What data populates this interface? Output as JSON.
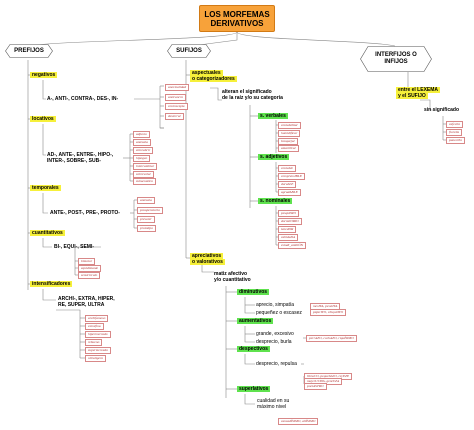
{
  "title": [
    "LOS MORFEMAS",
    "DERIVATIVOS"
  ],
  "branches": {
    "prefijos": "PREFIJOS",
    "sufijos": "SUFIJOS",
    "interfijos": [
      "INTERFIJOS O",
      "INFIJOS"
    ]
  },
  "prefijos": {
    "negativos": {
      "label": "negativos",
      "items": "A-, ANTI-, CONTRA-, DES-, IN-",
      "examples": [
        "anormalidad",
        "anticancro",
        "contraespía",
        "desterrar"
      ]
    },
    "locativos": {
      "label": "locativos",
      "items": [
        "AD-, ANTE-, ENTRE-, HIPO-,",
        "INTER-, SOBRE-, SUB-"
      ],
      "examples": [
        "adjunto",
        "antesala",
        "entreabrir",
        "hipogeo",
        "intercambiar",
        "sobrevolar",
        "subacuático"
      ]
    },
    "temporales": {
      "label": "temporales",
      "items": "ANTE-, POST-, PRE-, PROTO-",
      "examples": [
        "antesala",
        "posoperatorio",
        "prevenir",
        "prototipo"
      ]
    },
    "cuantitativos": {
      "label": "cuantitativos",
      "items": "BI-, EQUI-, SEMI-",
      "examples": [
        "bimotor",
        "equidistante",
        "semicírculo"
      ]
    },
    "intensificadores": {
      "label": "intensificadores",
      "items": [
        "ARCHI-, EXTRA, HIPER,",
        "RE, SUPER, ULTRA"
      ],
      "examples": [
        "archifamoso",
        "extrafina",
        "hipermercado",
        "rebueno",
        "supermercado",
        "ultraligero"
      ]
    }
  },
  "sufijos": {
    "aspectuales": {
      "label": [
        "aspectuales",
        "o categorizadores"
      ],
      "desc": [
        "alteran el significado",
        "de la raíz y/o su categoría"
      ]
    },
    "verbales": {
      "label": "s. verbales",
      "examples": [
        "contabilizar",
        "humidificar",
        "bosquejar",
        "amarillear"
      ]
    },
    "adjetivos": {
      "label": "s. adjetivos",
      "examples": [
        "contable",
        "comprensIBLE",
        "durabLE",
        "agradABLE"
      ]
    },
    "nominales": {
      "label": "s. nominales",
      "examples": [
        "pesquERO",
        "dormitORIO",
        "tenedOR",
        "cabidaDA",
        "estudi_ambiÓN"
      ]
    },
    "apreciativos": {
      "label": [
        "apreciativos",
        "o valorativos"
      ],
      "desc": [
        "matiz afectivo",
        "y/o cuantitativo"
      ]
    },
    "diminutivos": {
      "label": "diminutivos",
      "desc": [
        "aprecio, simpatía",
        "pequeñez o escasez"
      ],
      "examples": [
        "mesITA, pesetITA",
        "pájarITO, chiquitITO"
      ]
    },
    "aumentativos": {
      "label": "aumentativos",
      "desc": [
        "grande, excesivo",
        "desprecio, burla"
      ],
      "examples": [
        "perrAZO, cochAZO, riquÍSIMO"
      ]
    },
    "despectivos": {
      "label": "despectivos",
      "desc": [
        "desprecio, repulsa"
      ],
      "examples": [
        "libraCO, pequeñAJO, reyEZE",
        "mujerUCHA, gentUZA",
        "poetASTRO"
      ]
    },
    "superlativos": {
      "label": "superlativos",
      "desc": [
        "cualidad en su",
        "máximo nivel"
      ],
      "examples": [
        "cansadÍSIMO, altÍSIMO"
      ]
    }
  },
  "interfijos": {
    "label": [
      "entre el LEXEMA",
      "y el SUFIJO"
    ],
    "desc": "sin significado",
    "examples": [
      "cafecito",
      "florcita",
      "panecillo"
    ]
  }
}
